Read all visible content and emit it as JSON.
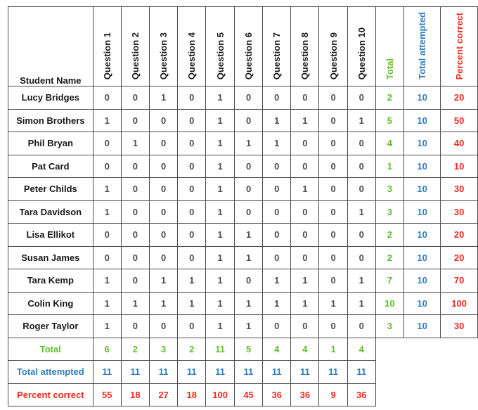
{
  "table": {
    "name_header": "Student Name",
    "question_headers": [
      "Question 1",
      "Question 2",
      "Question 3",
      "Question 4",
      "Question 5",
      "Question 6",
      "Question 7",
      "Question 8",
      "Question 9",
      "Question 10"
    ],
    "summary_headers": {
      "total": "Total",
      "total_attempted": "Total attempted",
      "percent_correct": "Percent correct"
    },
    "colors": {
      "green": "#5cbf2a",
      "blue": "#2f7ec1",
      "red": "#f3291c",
      "text": "#1a1a1a",
      "cell_text": "#4d4d4d",
      "border": "#4d4d4d"
    },
    "rows": [
      {
        "name": "Lucy Bridges",
        "answers": [
          0,
          0,
          1,
          0,
          1,
          0,
          0,
          0,
          0,
          0
        ],
        "total": 2,
        "attempted": 10,
        "percent": 20
      },
      {
        "name": "Simon Brothers",
        "answers": [
          1,
          0,
          0,
          0,
          1,
          0,
          1,
          1,
          0,
          1
        ],
        "total": 5,
        "attempted": 10,
        "percent": 50
      },
      {
        "name": "Phil Bryan",
        "answers": [
          0,
          1,
          0,
          0,
          1,
          1,
          1,
          0,
          0,
          0
        ],
        "total": 4,
        "attempted": 10,
        "percent": 40
      },
      {
        "name": "Pat Card",
        "answers": [
          0,
          0,
          0,
          0,
          1,
          0,
          0,
          0,
          0,
          0
        ],
        "total": 1,
        "attempted": 10,
        "percent": 10
      },
      {
        "name": "Peter Childs",
        "answers": [
          1,
          0,
          0,
          0,
          1,
          0,
          0,
          1,
          0,
          0
        ],
        "total": 3,
        "attempted": 10,
        "percent": 30
      },
      {
        "name": "Tara Davidson",
        "answers": [
          1,
          0,
          0,
          0,
          1,
          0,
          0,
          0,
          0,
          1
        ],
        "total": 3,
        "attempted": 10,
        "percent": 30
      },
      {
        "name": "Lisa Ellikot",
        "answers": [
          0,
          0,
          0,
          0,
          1,
          1,
          0,
          0,
          0,
          0
        ],
        "total": 2,
        "attempted": 10,
        "percent": 20
      },
      {
        "name": "Susan James",
        "answers": [
          0,
          0,
          0,
          0,
          1,
          1,
          0,
          0,
          0,
          0
        ],
        "total": 2,
        "attempted": 10,
        "percent": 20
      },
      {
        "name": "Tara Kemp",
        "answers": [
          1,
          0,
          1,
          1,
          1,
          0,
          1,
          1,
          0,
          1
        ],
        "total": 7,
        "attempted": 10,
        "percent": 70
      },
      {
        "name": "Colin King",
        "answers": [
          1,
          1,
          1,
          1,
          1,
          1,
          1,
          1,
          1,
          1
        ],
        "total": 10,
        "attempted": 10,
        "percent": 100
      },
      {
        "name": "Roger Taylor",
        "answers": [
          1,
          0,
          0,
          0,
          1,
          1,
          0,
          0,
          0,
          0
        ],
        "total": 3,
        "attempted": 10,
        "percent": 30
      }
    ],
    "footer": [
      {
        "label": "Total",
        "style": "green",
        "values": [
          6,
          2,
          3,
          2,
          11,
          5,
          4,
          4,
          1,
          4
        ]
      },
      {
        "label": "Total attempted",
        "style": "blue",
        "values": [
          11,
          11,
          11,
          11,
          11,
          11,
          11,
          11,
          11,
          11
        ]
      },
      {
        "label": "Percent correct",
        "style": "red",
        "values": [
          55,
          18,
          27,
          18,
          100,
          45,
          36,
          36,
          9,
          36
        ]
      }
    ]
  }
}
